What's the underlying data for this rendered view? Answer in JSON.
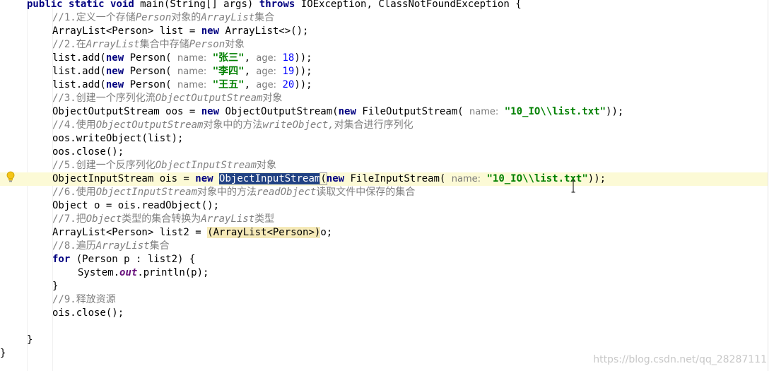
{
  "code": {
    "l0": {
      "kw1": "public",
      "kw2": "static",
      "kw3": "void",
      "t1": " main(String[] args) ",
      "kw4": "throws",
      "t2": " IOException, ClassNotFoundException {"
    },
    "l1": {
      "c1": "//1.",
      "c2": "定义一个存储",
      "c3": "Person",
      "c4": "对象的",
      "c5": "ArrayList",
      "c6": "集合"
    },
    "l2": {
      "t1": "ArrayList<Person> list = ",
      "kw": "new",
      "t2": " ArrayList<>();"
    },
    "l3": {
      "c1": "//2.",
      "c2": "在",
      "c3": "ArrayList",
      "c4": "集合中存储",
      "c5": "Person",
      "c6": "对象"
    },
    "l4": {
      "t1": "list.add(",
      "kw": "new",
      "t2": " Person( ",
      "h1": "name:",
      "s": "\"张三\"",
      "t3": ", ",
      "h2": "age:",
      "n": "18",
      "t4": "));"
    },
    "l5": {
      "t1": "list.add(",
      "kw": "new",
      "t2": " Person( ",
      "h1": "name:",
      "s": "\"李四\"",
      "t3": ", ",
      "h2": "age:",
      "n": "19",
      "t4": "));"
    },
    "l6": {
      "t1": "list.add(",
      "kw": "new",
      "t2": " Person( ",
      "h1": "name:",
      "s": "\"王五\"",
      "t3": ", ",
      "h2": "age:",
      "n": "20",
      "t4": "));"
    },
    "l7": {
      "c1": "//3.",
      "c2": "创建一个序列化流",
      "c3": "ObjectOutputStream",
      "c4": "对象"
    },
    "l8": {
      "t1": "ObjectOutputStream oos = ",
      "kw1": "new",
      "t2": " ObjectOutputStream(",
      "kw2": "new",
      "t3": " FileOutputStream( ",
      "h": "name:",
      "s": "\"10_IO\\\\list.txt\"",
      "t4": "));"
    },
    "l9": {
      "c1": "//4.",
      "c2": "使用",
      "c3": "ObjectOutputStream",
      "c4": "对象中的方法",
      "c5": "writeObject,",
      "c6": "对集合进行序列化"
    },
    "l10": {
      "t": "oos.writeObject(list);"
    },
    "l11": {
      "t": "oos.close();"
    },
    "l12": {
      "c1": "//5.",
      "c2": "创建一个反序列化",
      "c3": "ObjectInputStream",
      "c4": "对象"
    },
    "l13": {
      "t1": "ObjectInputStream ois = ",
      "kw1": "new",
      "sel": "ObjectInputStream",
      "p": "(",
      "kw2": "new",
      "t2": " FileInputStream( ",
      "h": "name:",
      "s": "\"10_IO\\\\list.txt\"",
      "t3": "));"
    },
    "l14": {
      "c1": "//6.",
      "c2": "使用",
      "c3": "ObjectInputStream",
      "c4": "对象中的方法",
      "c5": "readObject",
      "c6": "读取文件中保存的集合"
    },
    "l15": {
      "t": "Object o = ois.readObject();"
    },
    "l16": {
      "c1": "//7.",
      "c2": "把",
      "c3": "Object",
      "c4": "类型的集合转换为",
      "c5": "ArrayList",
      "c6": "类型"
    },
    "l17": {
      "t1": "ArrayList<Person> list2 = ",
      "cast": "(ArrayList<Person>)",
      "t2": "o;"
    },
    "l18": {
      "c1": "//8.",
      "c2": "遍历",
      "c3": "ArrayList",
      "c4": "集合"
    },
    "l19": {
      "kw": "for",
      "t": " (Person p : list2) {"
    },
    "l20": {
      "t1": "System.",
      "f": "out",
      "t2": ".println(p);"
    },
    "l21": {
      "t": "}"
    },
    "l22": {
      "c1": "//9.",
      "c2": "释放资源"
    },
    "l23": {
      "t": "ois.close();"
    },
    "l25": {
      "t": "}"
    },
    "l26": {
      "t": "}"
    }
  },
  "gutter": {
    "icon": "lightbulb-icon",
    "color": "#f5c518"
  },
  "watermark": "https://blog.csdn.net/qq_28287111",
  "colors": {
    "keyword": "#000080",
    "string": "#008000",
    "number": "#0000ff",
    "comment": "#808080",
    "selection": "#214283",
    "current_line": "#fcfad6"
  }
}
